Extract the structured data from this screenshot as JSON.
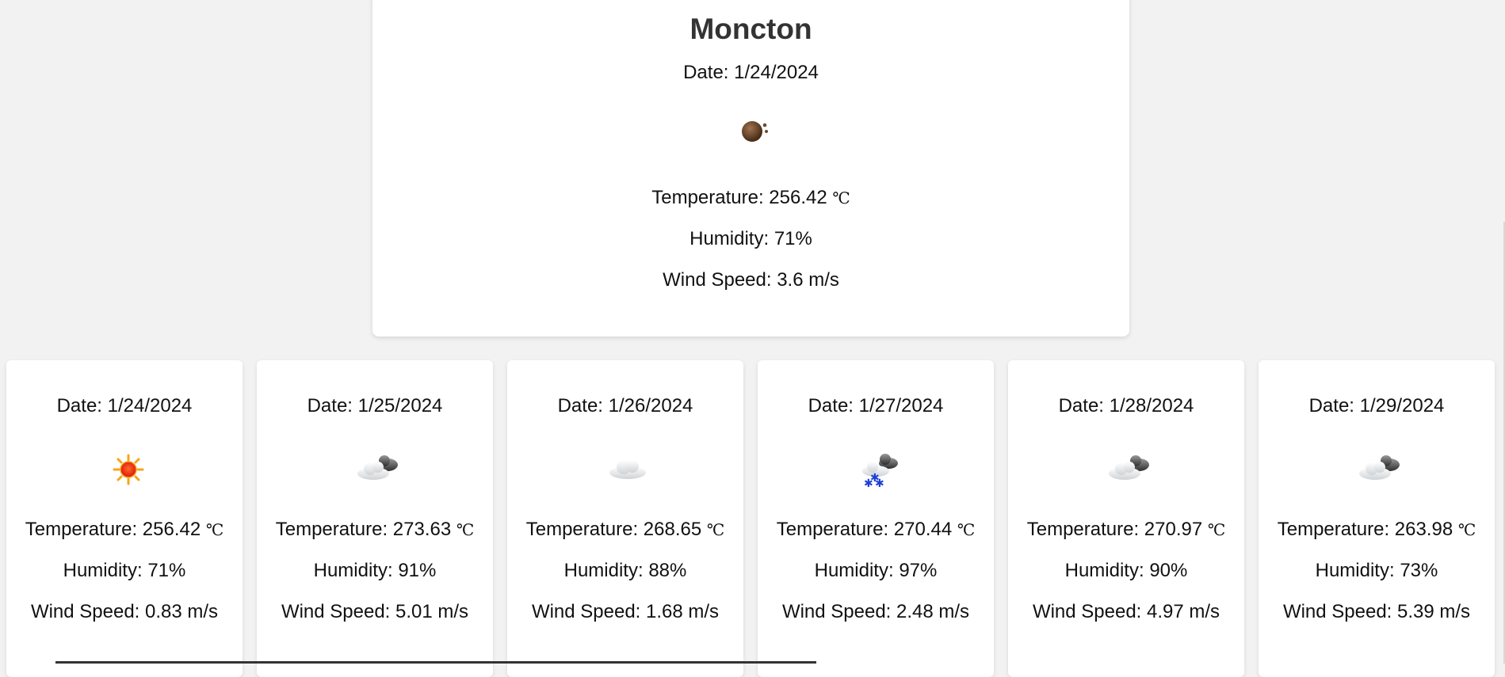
{
  "current": {
    "city": "Moncton",
    "date": "Date: 1/24/2024",
    "icon": "dust-icon",
    "temperature": "Temperature: 256.42 ",
    "unit": "℃",
    "humidity": "Humidity: 71%",
    "wind": "Wind Speed: 3.6 m/s"
  },
  "forecast": [
    {
      "date": "Date: 1/24/2024",
      "icon": "sun-icon",
      "temperature": "Temperature: 256.42 ",
      "unit": "℃",
      "humidity": "Humidity: 71%",
      "wind": "Wind Speed: 0.83 m/s"
    },
    {
      "date": "Date: 1/25/2024",
      "icon": "broken-clouds-icon",
      "temperature": "Temperature: 273.63 ",
      "unit": "℃",
      "humidity": "Humidity: 91%",
      "wind": "Wind Speed: 5.01 m/s"
    },
    {
      "date": "Date: 1/26/2024",
      "icon": "cloud-icon",
      "temperature": "Temperature: 268.65 ",
      "unit": "℃",
      "humidity": "Humidity: 88%",
      "wind": "Wind Speed: 1.68 m/s"
    },
    {
      "date": "Date: 1/27/2024",
      "icon": "snow-icon",
      "temperature": "Temperature: 270.44 ",
      "unit": "℃",
      "humidity": "Humidity: 97%",
      "wind": "Wind Speed: 2.48 m/s"
    },
    {
      "date": "Date: 1/28/2024",
      "icon": "broken-clouds-icon",
      "temperature": "Temperature: 270.97 ",
      "unit": "℃",
      "humidity": "Humidity: 90%",
      "wind": "Wind Speed: 4.97 m/s"
    },
    {
      "date": "Date: 1/29/2024",
      "icon": "broken-clouds-icon",
      "temperature": "Temperature: 263.98 ",
      "unit": "℃",
      "humidity": "Humidity: 73%",
      "wind": "Wind Speed: 5.39 m/s"
    }
  ]
}
